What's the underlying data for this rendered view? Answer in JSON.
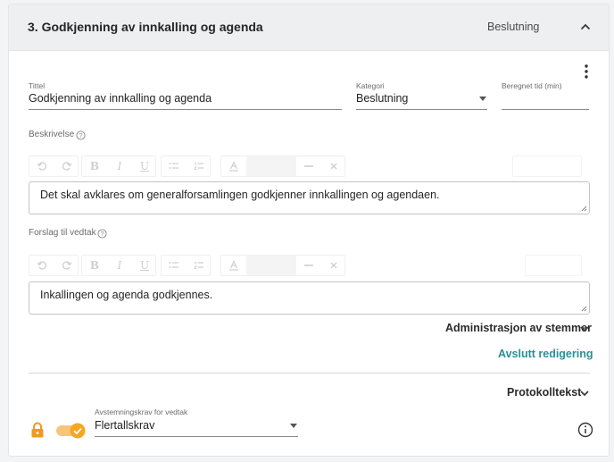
{
  "header": {
    "title": "3. Godkjenning av innkalling og agenda",
    "category": "Beslutning"
  },
  "fields": {
    "title_label": "Tittel",
    "title_value": "Godkjenning av innkalling og agenda",
    "category_label": "Kategori",
    "category_value": "Beslutning",
    "time_label": "Beregnet tid (min)",
    "time_value": ""
  },
  "description": {
    "label": "Beskrivelse",
    "text": "Det skal avklares om generalforsamlingen godkjenner innkallingen og agendaen."
  },
  "proposal": {
    "label": "Forslag til vedtak",
    "text": "Inkallingen og agenda godkjennes."
  },
  "actions": {
    "admin_votes": "Administrasjon av stemmer",
    "finish_editing": "Avslutt redigering",
    "protocol_text": "Protokolltekst"
  },
  "voting": {
    "label": "Avstemningskrav for vedtak",
    "value": "Flertallskrav",
    "toggle_on": true
  },
  "colors": {
    "accent": "#2a8f96",
    "toggle": "#f5a623",
    "lock": "#f09a1c",
    "header_bg": "#eeeff0"
  },
  "icons": [
    "chevron-up-icon",
    "kebab-menu-icon",
    "help-icon",
    "undo-icon",
    "redo-icon",
    "bold-icon",
    "italic-icon",
    "underline-icon",
    "bullet-list-icon",
    "numbered-list-icon",
    "text-color-icon",
    "horizontal-rule-icon",
    "clear-format-icon",
    "chevron-down-icon",
    "lock-icon",
    "check-icon",
    "info-icon"
  ]
}
